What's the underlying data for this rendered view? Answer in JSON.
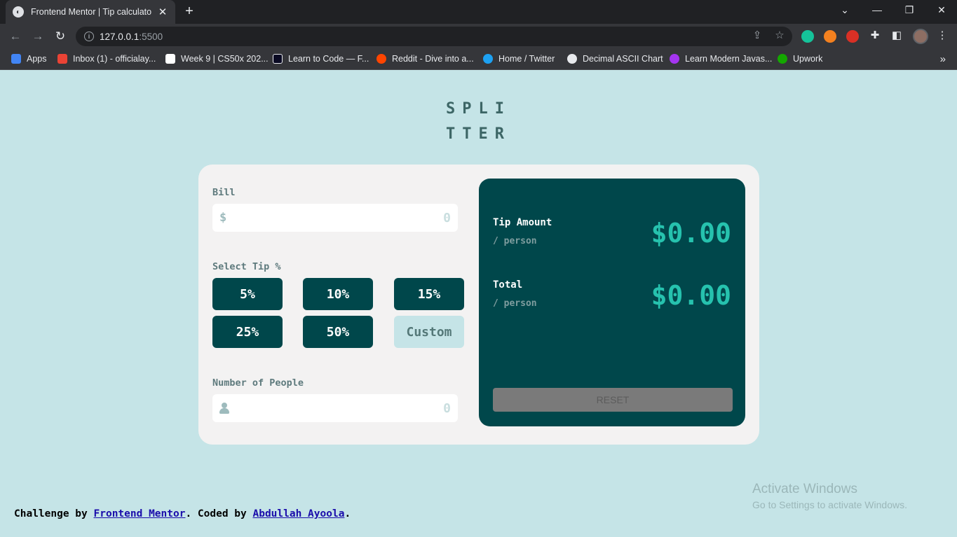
{
  "browser": {
    "tab_title": "Frontend Mentor | Tip calculator",
    "url_host": "127.0.0.1",
    "url_port": ":5500",
    "bookmarks": [
      {
        "label": "Apps",
        "color": "#4285f4"
      },
      {
        "label": "Inbox (1) - officialay...",
        "color": "#ea4335"
      },
      {
        "label": "Week 9 | CS50x 202...",
        "color": "#ffffff"
      },
      {
        "label": "Learn to Code — F...",
        "color": "#0a0a23"
      },
      {
        "label": "Reddit - Dive into a...",
        "color": "#ff4500"
      },
      {
        "label": "Home / Twitter",
        "color": "#1da1f2"
      },
      {
        "label": "Decimal ASCII Chart",
        "color": "#e8eaed"
      },
      {
        "label": "Learn Modern Javas...",
        "color": "#a435f0"
      },
      {
        "label": "Upwork",
        "color": "#14a800"
      }
    ]
  },
  "app": {
    "logo_line1": "SPLI",
    "logo_line2": "TTER",
    "bill_label": "Bill",
    "bill_prefix": "$",
    "bill_value": "0",
    "tip_label": "Select Tip %",
    "tips": [
      "5%",
      "10%",
      "15%",
      "25%",
      "50%"
    ],
    "custom_label": "Custom",
    "people_label": "Number of People",
    "people_value": "0",
    "tip_amount_label": "Tip Amount",
    "tip_amount_sub": "/ person",
    "tip_amount_value": "$0.00",
    "total_label": "Total",
    "total_sub": "/ person",
    "total_value": "$0.00",
    "reset_label": "RESET"
  },
  "footer": {
    "prefix": "Challenge by ",
    "link1": "Frontend Mentor",
    "middle": ". Coded by ",
    "link2": "Abdullah Ayoola",
    "suffix": "."
  },
  "watermark": {
    "line1": "Activate Windows",
    "line2": "Go to Settings to activate Windows."
  },
  "colors": {
    "accent": "#26c2ae",
    "dark_teal": "#00474b",
    "background": "#c5e4e7"
  }
}
